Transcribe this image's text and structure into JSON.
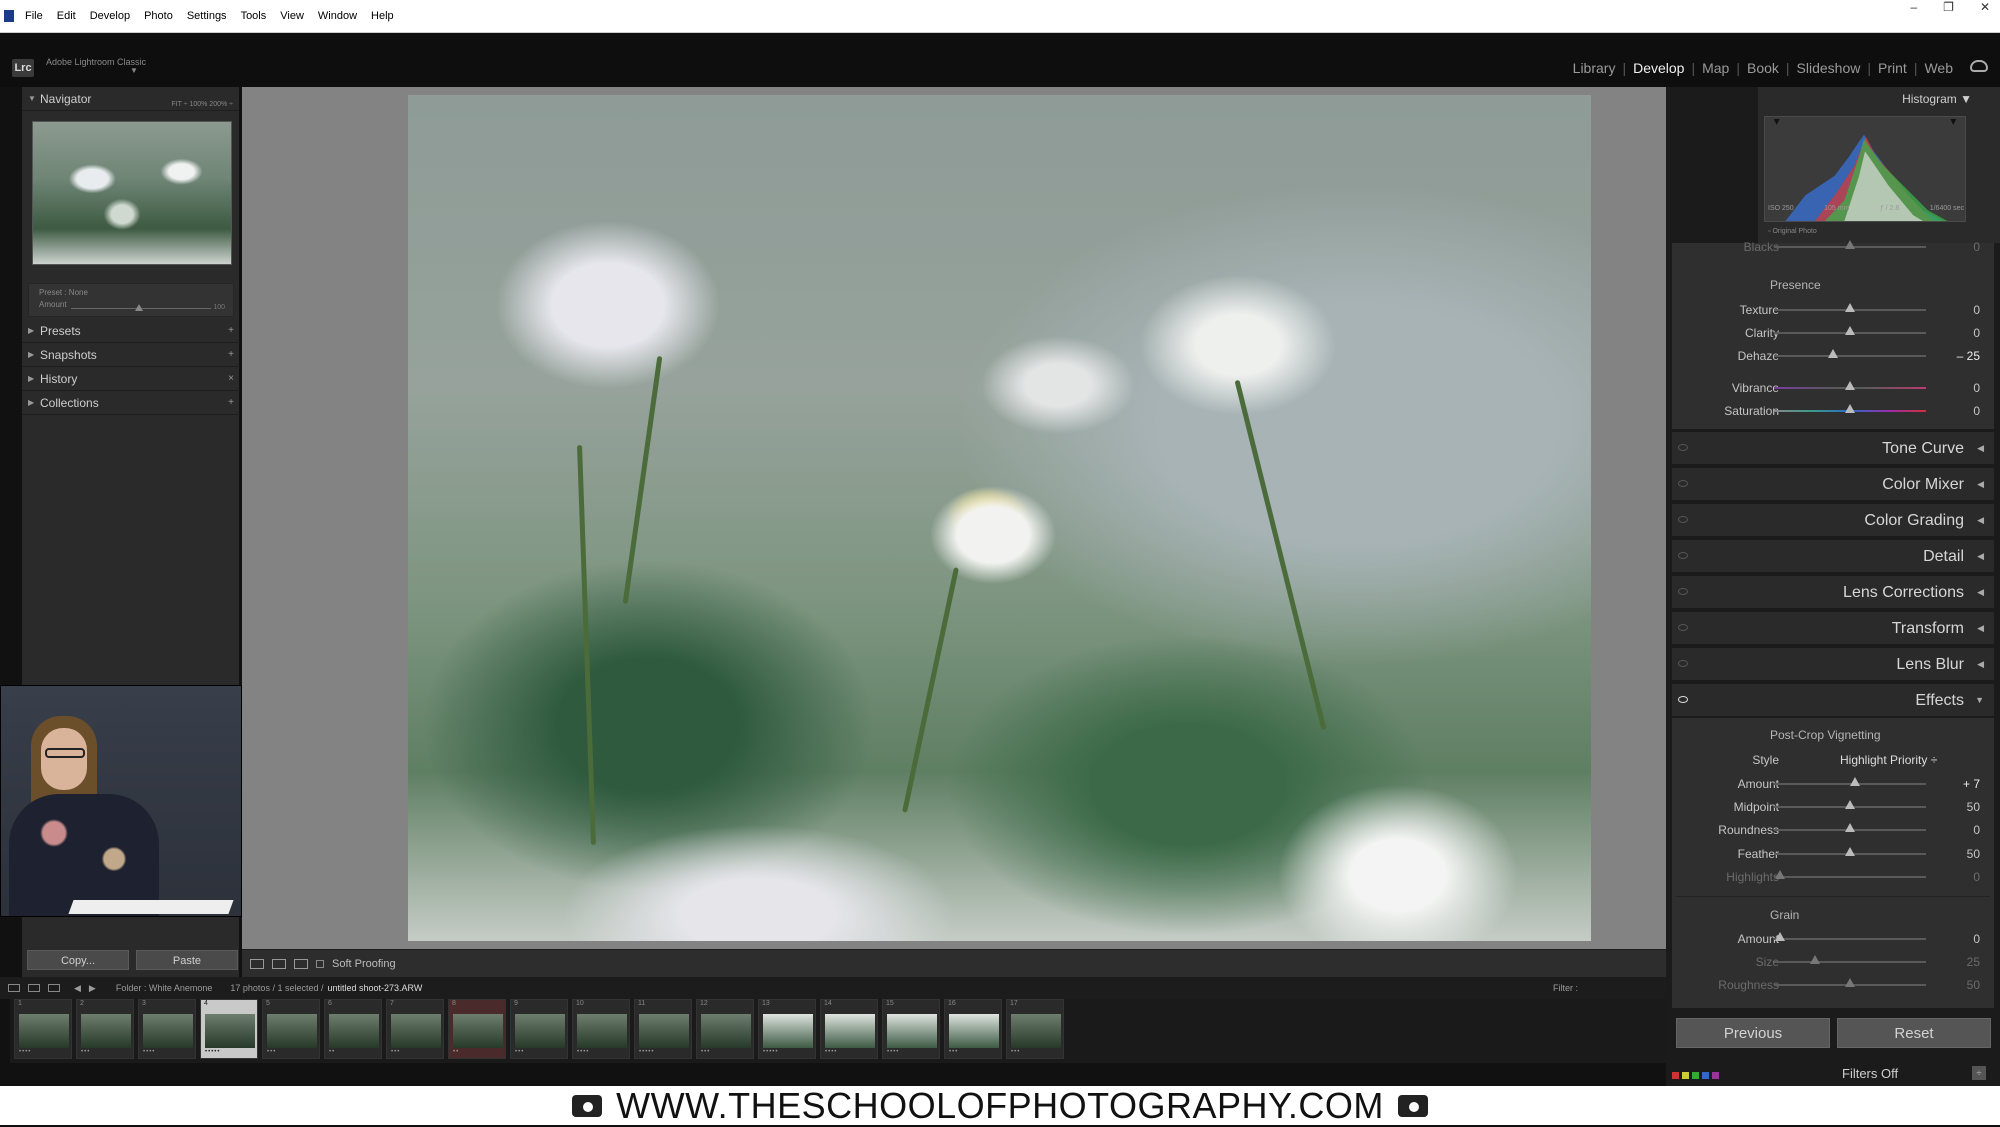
{
  "menubar": {
    "items": [
      "File",
      "Edit",
      "Develop",
      "Photo",
      "Settings",
      "Tools",
      "View",
      "Window",
      "Help"
    ],
    "window_controls": [
      "–",
      "❐",
      "✕"
    ]
  },
  "topbar": {
    "logo": "Lrc",
    "brand": "Adobe Lightroom Classic",
    "modules": [
      "Library",
      "Develop",
      "Map",
      "Book",
      "Slideshow",
      "Print",
      "Web"
    ],
    "active_module": "Develop"
  },
  "left": {
    "navigator": "Navigator",
    "nav_zoom": "FIT ÷   100%   200%   ÷",
    "preset_label": "Preset :  None",
    "amount_label": "Amount",
    "amount_value": "100",
    "panels": [
      "Presets",
      "Snapshots",
      "History",
      "Collections"
    ],
    "copy": "Copy...",
    "paste": "Paste"
  },
  "toolbar": {
    "soft_proofing": "Soft Proofing"
  },
  "filmbar": {
    "folder": "Folder : White Anemone",
    "count": "17 photos / 1 selected /",
    "filename": "untitled shoot-273.ARW",
    "filter": "Filter :"
  },
  "filmstrip": {
    "numbers": [
      "1",
      "2",
      "3",
      "4",
      "5",
      "6",
      "7",
      "8",
      "9",
      "10",
      "11",
      "12",
      "13",
      "14",
      "15",
      "16",
      "17"
    ]
  },
  "histogram": {
    "title": "Histogram",
    "iso": "ISO 250",
    "focal": "105 mm",
    "aperture": "ƒ / 2.8",
    "shutter": "1/6400 sec",
    "original": "Original Photo"
  },
  "basic": {
    "blacks": {
      "label": "Blacks",
      "value": "0",
      "pos": 0.5
    },
    "presence": "Presence",
    "texture": {
      "label": "Texture",
      "value": "0",
      "pos": 0.5
    },
    "clarity": {
      "label": "Clarity",
      "value": "0",
      "pos": 0.5
    },
    "dehaze": {
      "label": "Dehaze",
      "value": "– 25",
      "pos": 0.39
    },
    "vibrance": {
      "label": "Vibrance",
      "value": "0",
      "pos": 0.5
    },
    "saturation": {
      "label": "Saturation",
      "value": "0",
      "pos": 0.5
    }
  },
  "panels": [
    "Tone Curve",
    "Color Mixer",
    "Color Grading",
    "Detail",
    "Lens Corrections",
    "Transform",
    "Lens Blur",
    "Effects"
  ],
  "effects": {
    "vignette_title": "Post-Crop Vignetting",
    "style_label": "Style",
    "style_value": "Highlight Priority ÷",
    "amount": {
      "label": "Amount",
      "value": "+ 7",
      "pos": 0.53
    },
    "midpoint": {
      "label": "Midpoint",
      "value": "50",
      "pos": 0.5
    },
    "roundness": {
      "label": "Roundness",
      "value": "0",
      "pos": 0.5
    },
    "feather": {
      "label": "Feather",
      "value": "50",
      "pos": 0.5
    },
    "highlights": {
      "label": "Highlights",
      "value": "0",
      "pos": 0.04
    },
    "grain_title": "Grain",
    "g_amount": {
      "label": "Amount",
      "value": "0",
      "pos": 0.04
    },
    "size": {
      "label": "Size",
      "value": "25",
      "pos": 0.27
    },
    "roughness": {
      "label": "Roughness",
      "value": "50",
      "pos": 0.5
    }
  },
  "buttons": {
    "previous": "Previous",
    "reset": "Reset"
  },
  "filters_off": "Filters Off",
  "banner": "WWW.THESCHOOLOFPHOTOGRAPHY.COM",
  "colors": {
    "background": "#111111",
    "panel": "#2f2f2f",
    "accent": "#f1f1f1"
  }
}
